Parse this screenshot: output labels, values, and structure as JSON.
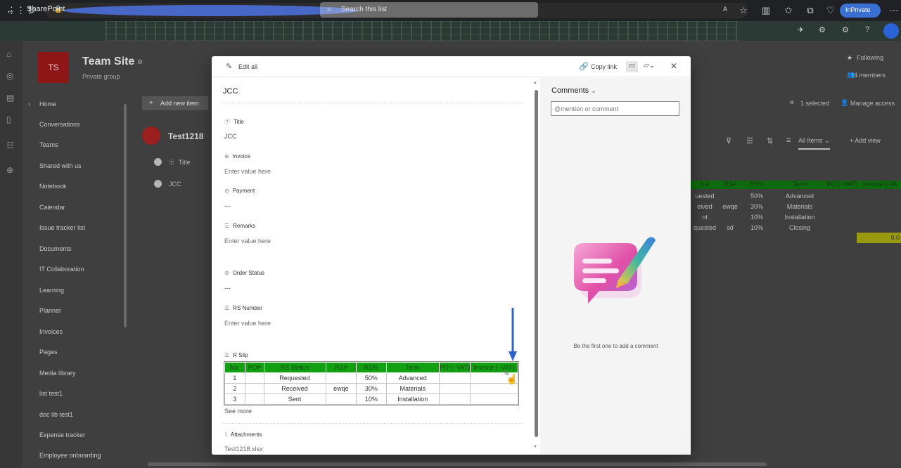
{
  "browser": {
    "inprivate_label": "InPrivate"
  },
  "suite_bar": {
    "brand": "SharePoint",
    "search_placeholder": "Search this list"
  },
  "site": {
    "logo_initials": "TS",
    "title": "Team Site",
    "subtitle": "Private group",
    "following_label": "Following",
    "members_label": "4 members",
    "nav": [
      "Home",
      "Conversations",
      "Teams",
      "Shared with us",
      "Notebook",
      "Calendar",
      "Issue tracker list",
      "Documents",
      "IT Collaboration",
      "Learning",
      "Planner",
      "Invoices",
      "Pages",
      "Media library",
      "list test1",
      "doc lib test1",
      "Expense tracker",
      "Employee onboarding"
    ]
  },
  "list": {
    "add_new_item": "Add new item",
    "name": "Test1218",
    "title_column": "Title",
    "row_title": "JCC",
    "selected_label": "1 selected",
    "manage_access": "Manage access",
    "view_name": "All Items",
    "add_view": "Add view",
    "bg_table_header": [
      "tus",
      "RS#",
      "RS%",
      "Term",
      "PO (- VAT)",
      "Invoice (-VA"
    ],
    "bg_table_rows": [
      [
        "uested",
        "",
        "50%",
        "Advanced"
      ],
      [
        "eived",
        "ewqe",
        "30%",
        "Materials"
      ],
      [
        "nt",
        "",
        "10%",
        "Installation"
      ],
      [
        "quested",
        "sd",
        "10%",
        "Closing"
      ]
    ],
    "bg_yellow_value": "0.0"
  },
  "panel": {
    "edit_all": "Edit all",
    "copy_link": "Copy link",
    "item_title": "JCC",
    "fields": [
      {
        "label": "Title",
        "value": "JCC",
        "placeholder": false
      },
      {
        "label": "Invoice",
        "value": "Enter value here",
        "placeholder": true
      },
      {
        "label": "Payment",
        "value": "---",
        "placeholder": false
      },
      {
        "label": "Remarks",
        "value": "Enter value here",
        "placeholder": true
      },
      {
        "label": "Order Status",
        "value": "---",
        "placeholder": false
      },
      {
        "label": "RS Number",
        "value": "Enter value here",
        "placeholder": true
      }
    ],
    "rslip_label": "R Slip",
    "rslip_headers": [
      "No.",
      "PO#",
      "RS Status",
      "RS#",
      "RS%",
      "Term",
      "PO (- VAT)",
      "Invoice (- VAT)"
    ],
    "rslip_rows": [
      [
        "1",
        "",
        "Requested",
        "",
        "50%",
        "Advanced",
        "",
        ""
      ],
      [
        "2",
        "",
        "Received",
        "ewqe",
        "30%",
        "Materials",
        "",
        ""
      ],
      [
        "3",
        "",
        "Sent",
        "",
        "10%",
        "Installation",
        "",
        ""
      ]
    ],
    "see_more": "See more",
    "attachments_label": "Attachments",
    "attachment_file": "Test1218.xlsx"
  },
  "comments": {
    "title": "Comments",
    "input_placeholder": "@mention or comment",
    "empty_text": "Be the first one to add a comment"
  },
  "colors": {
    "table_header_green": "#12a012",
    "arrow_blue": "#2f63c7",
    "site_logo_red": "#8f1616"
  }
}
